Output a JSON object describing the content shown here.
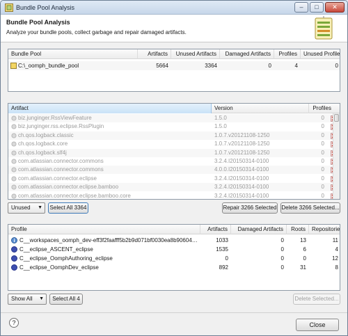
{
  "window": {
    "title": "Bundle Pool Analysis",
    "min": "–",
    "max": "□",
    "close": "✕"
  },
  "header": {
    "title": "Bundle Pool Analysis",
    "description": "Analyze your bundle pools, collect garbage and repair damaged artifacts."
  },
  "pools": {
    "columns": [
      "Bundle Pool",
      "Artifacts",
      "Unused Artifacts",
      "Damaged Artifacts",
      "Profiles",
      "Unused Profiles"
    ],
    "rows": [
      {
        "name": "C:\\_oomph_bundle_pool",
        "artifacts": "5664",
        "unused": "3364",
        "damaged": "0",
        "profiles": "4",
        "unused_profiles": "0"
      }
    ]
  },
  "artifacts": {
    "columns": [
      "Artifact",
      "Version",
      "Profiles"
    ],
    "rows": [
      {
        "name": "biz.junginger.RssViewFeature",
        "version": "1.5.0",
        "profiles": "0"
      },
      {
        "name": "biz.junginger.rss.eclipse.RssPlugin",
        "version": "1.5.0",
        "profiles": "0"
      },
      {
        "name": "ch.qos.logback.classic",
        "version": "1.0.7.v20121108-1250",
        "profiles": "0"
      },
      {
        "name": "ch.qos.logback.core",
        "version": "1.0.7.v20121108-1250",
        "profiles": "0"
      },
      {
        "name": "ch.qos.logback.slf4j",
        "version": "1.0.7.v20121108-1250",
        "profiles": "0"
      },
      {
        "name": "com.atlassian.connector.commons",
        "version": "3.2.4.I20150314-0100",
        "profiles": "0"
      },
      {
        "name": "com.atlassian.connector.commons",
        "version": "4.0.0.I20150314-0100",
        "profiles": "0"
      },
      {
        "name": "com.atlassian.connector.eclipse",
        "version": "3.2.4.I20150314-0100",
        "profiles": "0"
      },
      {
        "name": "com.atlassian.connector.eclipse.bamboo",
        "version": "3.2.4.I20150314-0100",
        "profiles": "0"
      },
      {
        "name": "com.atlassian.connector.eclipse.bamboo.core",
        "version": "3.2.4.I20150314-0100",
        "profiles": "0"
      }
    ],
    "filter": {
      "value": "Unused",
      "arrow": "▼"
    },
    "select_all": "Select All 3364",
    "repair": "Repair 3266 Selected",
    "delete": "Delete 3266 Selected..."
  },
  "profiles": {
    "columns": [
      "Profile",
      "Artifacts",
      "Damaged Artifacts",
      "Roots",
      "Repositories"
    ],
    "rows": [
      {
        "name": "C__workspaces_oomph_dev-eff3f2faafff5b2b9d071bf0030ea8b90604…",
        "artifacts": "1033",
        "damaged": "0",
        "roots": "13",
        "repos": "11"
      },
      {
        "name": "C__eclipse_ASCENT_eclipse",
        "artifacts": "1535",
        "damaged": "0",
        "roots": "6",
        "repos": "4"
      },
      {
        "name": "C__eclipse_OomphAuthoring_eclipse",
        "artifacts": "0",
        "damaged": "0",
        "roots": "0",
        "repos": "12"
      },
      {
        "name": "C__eclipse_OomphDev_eclipse",
        "artifacts": "892",
        "damaged": "0",
        "roots": "31",
        "repos": "8"
      }
    ],
    "filter": {
      "value": "Show All",
      "arrow": "▼"
    },
    "select_all": "Select All 4",
    "delete": "Delete Selected..."
  },
  "footer": {
    "help": "?",
    "close": "Close"
  },
  "colors": {
    "accent": "#3d63a8",
    "selection": "#dbe9fb",
    "header_bg": "#ffffff",
    "dialog_bg": "#f0f0f0"
  }
}
